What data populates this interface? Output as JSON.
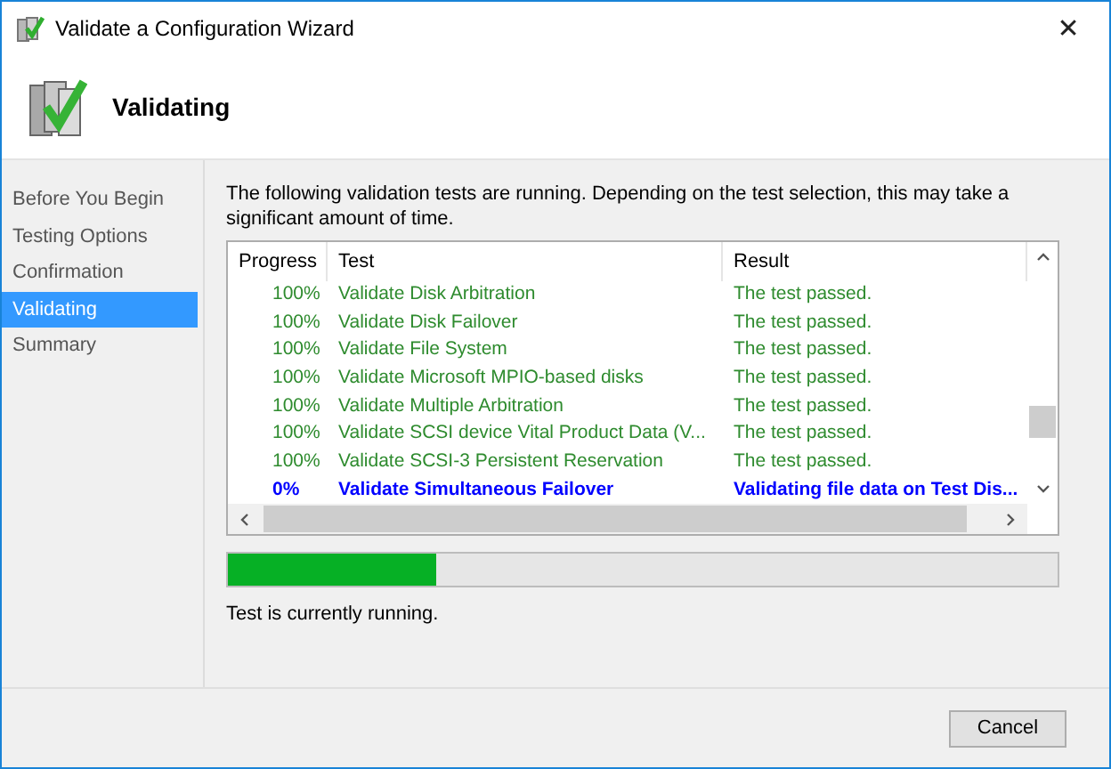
{
  "window": {
    "title": "Validate a Configuration Wizard",
    "close": "✕"
  },
  "header": {
    "title": "Validating"
  },
  "sidebar": {
    "items": [
      {
        "label": "Before You Begin",
        "selected": false
      },
      {
        "label": "Testing Options",
        "selected": false
      },
      {
        "label": "Confirmation",
        "selected": false
      },
      {
        "label": "Validating",
        "selected": true
      },
      {
        "label": "Summary",
        "selected": false
      }
    ]
  },
  "description": "The following validation tests are running. Depending on the test selection, this may take a significant amount of time.",
  "table": {
    "columns": [
      "Progress",
      "Test",
      "Result"
    ],
    "rows": [
      {
        "kind": "passed",
        "progress": "100%",
        "test": "Validate Disk Arbitration",
        "result": "The test passed."
      },
      {
        "kind": "passed",
        "progress": "100%",
        "test": "Validate Disk Failover",
        "result": "The test passed."
      },
      {
        "kind": "passed",
        "progress": "100%",
        "test": "Validate File System",
        "result": "The test passed."
      },
      {
        "kind": "passed",
        "progress": "100%",
        "test": "Validate Microsoft MPIO-based disks",
        "result": "The test passed."
      },
      {
        "kind": "passed",
        "progress": "100%",
        "test": "Validate Multiple Arbitration",
        "result": "The test passed."
      },
      {
        "kind": "passed",
        "progress": "100%",
        "test": "Validate SCSI device Vital Product Data (V...",
        "result": "The test passed."
      },
      {
        "kind": "passed",
        "progress": "100%",
        "test": "Validate SCSI-3 Persistent Reservation",
        "result": "The test passed."
      },
      {
        "kind": "running",
        "progress": "0%",
        "test": "Validate Simultaneous Failover",
        "result": "Validating file data on Test Dis..."
      }
    ]
  },
  "progress": {
    "level": 0.25,
    "status": "Test is currently running."
  },
  "buttons": [
    "Cancel"
  ]
}
